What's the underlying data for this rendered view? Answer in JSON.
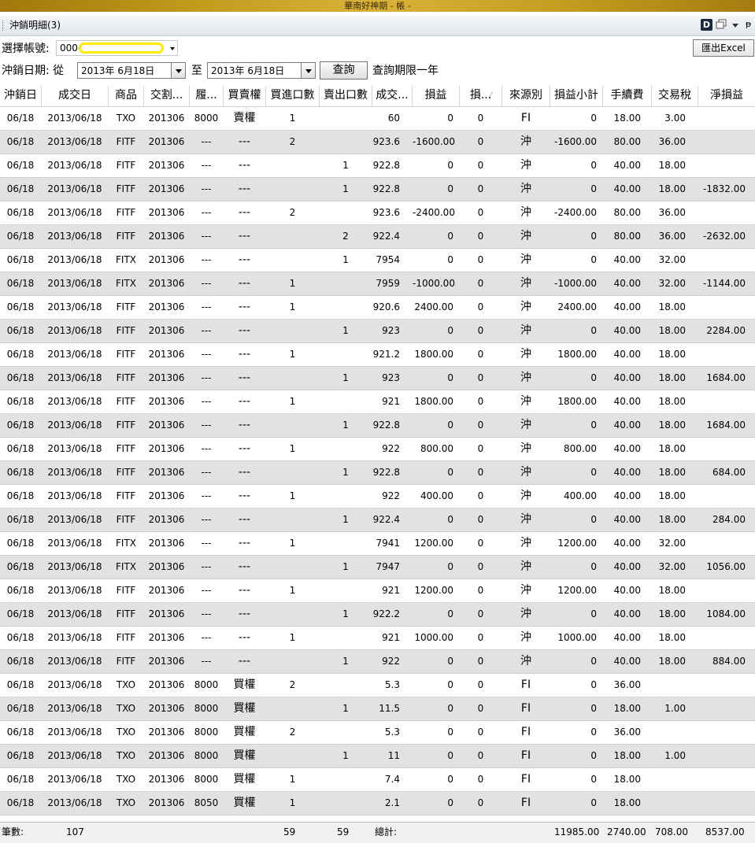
{
  "window": {
    "title": "華南好神期 - 帳 -"
  },
  "panel": {
    "title": "沖銷明細(3)",
    "d_icon_label": "D",
    "pin_glyph": "ᵽ"
  },
  "account": {
    "label": "選擇帳號:",
    "prefix": "000-"
  },
  "export": {
    "label": "匯出Excel"
  },
  "date_filter": {
    "label": "沖銷日期: 從",
    "from": "2013年  6月18日",
    "to_label": "至",
    "to": "2013年  6月18日"
  },
  "query": {
    "label": "查詢",
    "limit_note": "查詢期限一年"
  },
  "columns": [
    "沖銷日",
    "成交日",
    "商品",
    "交割...",
    "履...",
    "買賣權",
    "買進口數",
    "賣出口數",
    "成交...",
    "損益",
    "損...",
    "來源別",
    "損益小計",
    "手續費",
    "交易稅",
    "淨損益"
  ],
  "rows": [
    [
      "06/18",
      "2013/06/18",
      "TXO",
      "201306",
      "8000",
      "賣權",
      "1",
      "",
      "60",
      "0",
      "0",
      "FI",
      "0",
      "18.00",
      "3.00",
      ""
    ],
    [
      "06/18",
      "2013/06/18",
      "FITF",
      "201306",
      "---",
      "---",
      "2",
      "",
      "923.6",
      "-1600.00",
      "0",
      "沖",
      "-1600.00",
      "80.00",
      "36.00",
      ""
    ],
    [
      "06/18",
      "2013/06/18",
      "FITF",
      "201306",
      "---",
      "---",
      "",
      "1",
      "922.8",
      "0",
      "0",
      "沖",
      "0",
      "40.00",
      "18.00",
      ""
    ],
    [
      "06/18",
      "2013/06/18",
      "FITF",
      "201306",
      "---",
      "---",
      "",
      "1",
      "922.8",
      "0",
      "0",
      "沖",
      "0",
      "40.00",
      "18.00",
      "-1832.00"
    ],
    [
      "06/18",
      "2013/06/18",
      "FITF",
      "201306",
      "---",
      "---",
      "2",
      "",
      "923.6",
      "-2400.00",
      "0",
      "沖",
      "-2400.00",
      "80.00",
      "36.00",
      ""
    ],
    [
      "06/18",
      "2013/06/18",
      "FITF",
      "201306",
      "---",
      "---",
      "",
      "2",
      "922.4",
      "0",
      "0",
      "沖",
      "0",
      "80.00",
      "36.00",
      "-2632.00"
    ],
    [
      "06/18",
      "2013/06/18",
      "FITX",
      "201306",
      "---",
      "---",
      "",
      "1",
      "7954",
      "0",
      "0",
      "沖",
      "0",
      "40.00",
      "32.00",
      ""
    ],
    [
      "06/18",
      "2013/06/18",
      "FITX",
      "201306",
      "---",
      "---",
      "1",
      "",
      "7959",
      "-1000.00",
      "0",
      "沖",
      "-1000.00",
      "40.00",
      "32.00",
      "-1144.00"
    ],
    [
      "06/18",
      "2013/06/18",
      "FITF",
      "201306",
      "---",
      "---",
      "1",
      "",
      "920.6",
      "2400.00",
      "0",
      "沖",
      "2400.00",
      "40.00",
      "18.00",
      ""
    ],
    [
      "06/18",
      "2013/06/18",
      "FITF",
      "201306",
      "---",
      "---",
      "",
      "1",
      "923",
      "0",
      "0",
      "沖",
      "0",
      "40.00",
      "18.00",
      "2284.00"
    ],
    [
      "06/18",
      "2013/06/18",
      "FITF",
      "201306",
      "---",
      "---",
      "1",
      "",
      "921.2",
      "1800.00",
      "0",
      "沖",
      "1800.00",
      "40.00",
      "18.00",
      ""
    ],
    [
      "06/18",
      "2013/06/18",
      "FITF",
      "201306",
      "---",
      "---",
      "",
      "1",
      "923",
      "0",
      "0",
      "沖",
      "0",
      "40.00",
      "18.00",
      "1684.00"
    ],
    [
      "06/18",
      "2013/06/18",
      "FITF",
      "201306",
      "---",
      "---",
      "1",
      "",
      "921",
      "1800.00",
      "0",
      "沖",
      "1800.00",
      "40.00",
      "18.00",
      ""
    ],
    [
      "06/18",
      "2013/06/18",
      "FITF",
      "201306",
      "---",
      "---",
      "",
      "1",
      "922.8",
      "0",
      "0",
      "沖",
      "0",
      "40.00",
      "18.00",
      "1684.00"
    ],
    [
      "06/18",
      "2013/06/18",
      "FITF",
      "201306",
      "---",
      "---",
      "1",
      "",
      "922",
      "800.00",
      "0",
      "沖",
      "800.00",
      "40.00",
      "18.00",
      ""
    ],
    [
      "06/18",
      "2013/06/18",
      "FITF",
      "201306",
      "---",
      "---",
      "",
      "1",
      "922.8",
      "0",
      "0",
      "沖",
      "0",
      "40.00",
      "18.00",
      "684.00"
    ],
    [
      "06/18",
      "2013/06/18",
      "FITF",
      "201306",
      "---",
      "---",
      "1",
      "",
      "922",
      "400.00",
      "0",
      "沖",
      "400.00",
      "40.00",
      "18.00",
      ""
    ],
    [
      "06/18",
      "2013/06/18",
      "FITF",
      "201306",
      "---",
      "---",
      "",
      "1",
      "922.4",
      "0",
      "0",
      "沖",
      "0",
      "40.00",
      "18.00",
      "284.00"
    ],
    [
      "06/18",
      "2013/06/18",
      "FITX",
      "201306",
      "---",
      "---",
      "1",
      "",
      "7941",
      "1200.00",
      "0",
      "沖",
      "1200.00",
      "40.00",
      "32.00",
      ""
    ],
    [
      "06/18",
      "2013/06/18",
      "FITX",
      "201306",
      "---",
      "---",
      "",
      "1",
      "7947",
      "0",
      "0",
      "沖",
      "0",
      "40.00",
      "32.00",
      "1056.00"
    ],
    [
      "06/18",
      "2013/06/18",
      "FITF",
      "201306",
      "---",
      "---",
      "1",
      "",
      "921",
      "1200.00",
      "0",
      "沖",
      "1200.00",
      "40.00",
      "18.00",
      ""
    ],
    [
      "06/18",
      "2013/06/18",
      "FITF",
      "201306",
      "---",
      "---",
      "",
      "1",
      "922.2",
      "0",
      "0",
      "沖",
      "0",
      "40.00",
      "18.00",
      "1084.00"
    ],
    [
      "06/18",
      "2013/06/18",
      "FITF",
      "201306",
      "---",
      "---",
      "1",
      "",
      "921",
      "1000.00",
      "0",
      "沖",
      "1000.00",
      "40.00",
      "18.00",
      ""
    ],
    [
      "06/18",
      "2013/06/18",
      "FITF",
      "201306",
      "---",
      "---",
      "",
      "1",
      "922",
      "0",
      "0",
      "沖",
      "0",
      "40.00",
      "18.00",
      "884.00"
    ],
    [
      "06/18",
      "2013/06/18",
      "TXO",
      "201306",
      "8000",
      "買權",
      "2",
      "",
      "5.3",
      "0",
      "0",
      "FI",
      "0",
      "36.00",
      "",
      ""
    ],
    [
      "06/18",
      "2013/06/18",
      "TXO",
      "201306",
      "8000",
      "買權",
      "",
      "1",
      "11.5",
      "0",
      "0",
      "FI",
      "0",
      "18.00",
      "1.00",
      ""
    ],
    [
      "06/18",
      "2013/06/18",
      "TXO",
      "201306",
      "8000",
      "買權",
      "2",
      "",
      "5.3",
      "0",
      "0",
      "FI",
      "0",
      "36.00",
      "",
      ""
    ],
    [
      "06/18",
      "2013/06/18",
      "TXO",
      "201306",
      "8000",
      "買權",
      "",
      "1",
      "11",
      "0",
      "0",
      "FI",
      "0",
      "18.00",
      "1.00",
      ""
    ],
    [
      "06/18",
      "2013/06/18",
      "TXO",
      "201306",
      "8000",
      "買權",
      "1",
      "",
      "7.4",
      "0",
      "0",
      "FI",
      "0",
      "18.00",
      "",
      ""
    ],
    [
      "06/18",
      "2013/06/18",
      "TXO",
      "201306",
      "8050",
      "買權",
      "1",
      "",
      "2.1",
      "0",
      "0",
      "FI",
      "0",
      "18.00",
      "",
      ""
    ]
  ],
  "summary": {
    "count_label": "筆數:",
    "count": "107",
    "buy_qty": "59",
    "sell_qty": "59",
    "total_label": "總計:",
    "pnl_subtotal": "11985.00",
    "fee": "2740.00",
    "tax": "708.00",
    "net": "8537.00"
  }
}
